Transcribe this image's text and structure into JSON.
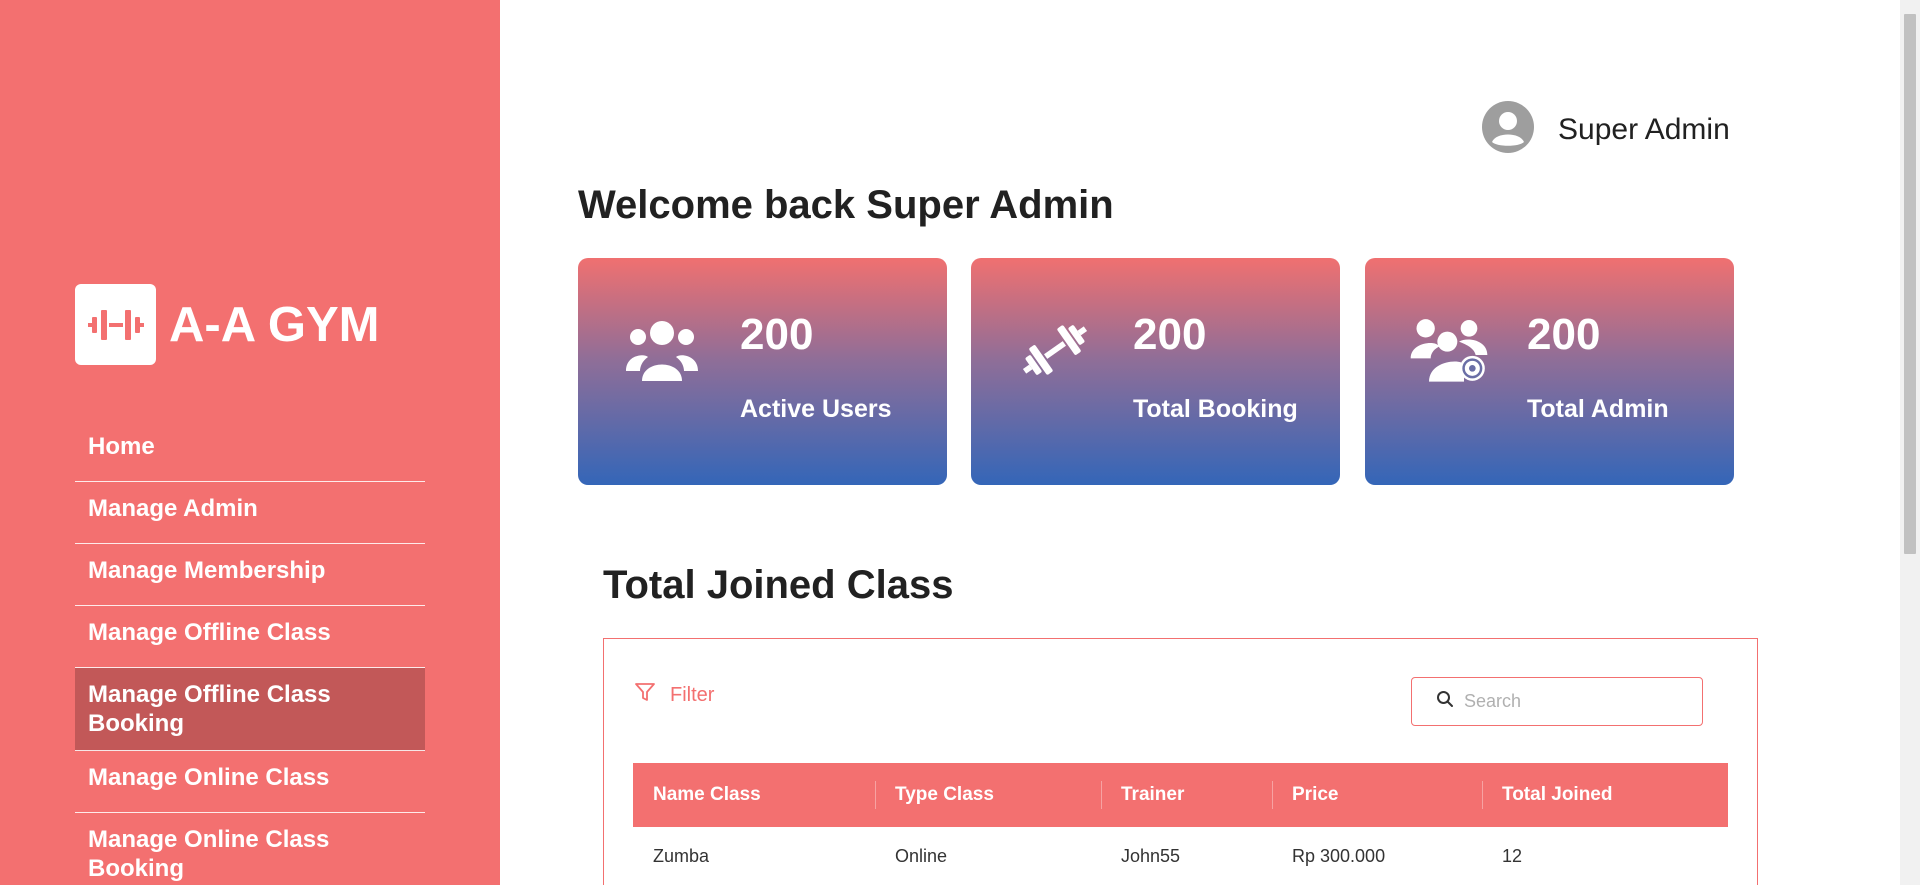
{
  "brand": {
    "name": "A-A GYM",
    "logo_icon": "dumbbell-icon"
  },
  "nav": {
    "items": [
      {
        "label": "Home",
        "active": false
      },
      {
        "label": "Manage Admin",
        "active": false
      },
      {
        "label": "Manage Membership",
        "active": false
      },
      {
        "label": "Manage Offline Class",
        "active": false
      },
      {
        "label": "Manage Offline Class Booking",
        "active": true
      },
      {
        "label": "Manage Online Class",
        "active": false
      },
      {
        "label": "Manage Online Class Booking",
        "active": false
      }
    ]
  },
  "header": {
    "user_name": "Super Admin",
    "avatar_icon": "user-circle-icon"
  },
  "welcome": {
    "title": "Welcome back Super Admin"
  },
  "stats": [
    {
      "value": "200",
      "label": "Active Users",
      "icon": "users-group-icon"
    },
    {
      "value": "200",
      "label": "Total Booking",
      "icon": "dumbbell-icon"
    },
    {
      "value": "200",
      "label": "Total Admin",
      "icon": "users-gear-icon"
    }
  ],
  "joined": {
    "title": "Total Joined Class",
    "filter_label": "Filter",
    "search_placeholder": "Search",
    "columns": [
      "Name Class",
      "Type Class",
      "Trainer",
      "Price",
      "Total Joined"
    ],
    "rows": [
      [
        "Zumba",
        "Online",
        "John55",
        "Rp 300.000",
        "12"
      ]
    ]
  },
  "colors": {
    "sidebar": "#f37070",
    "active_nav": "#c25858",
    "card_top": "#f07070",
    "card_bottom": "#3466b8"
  }
}
